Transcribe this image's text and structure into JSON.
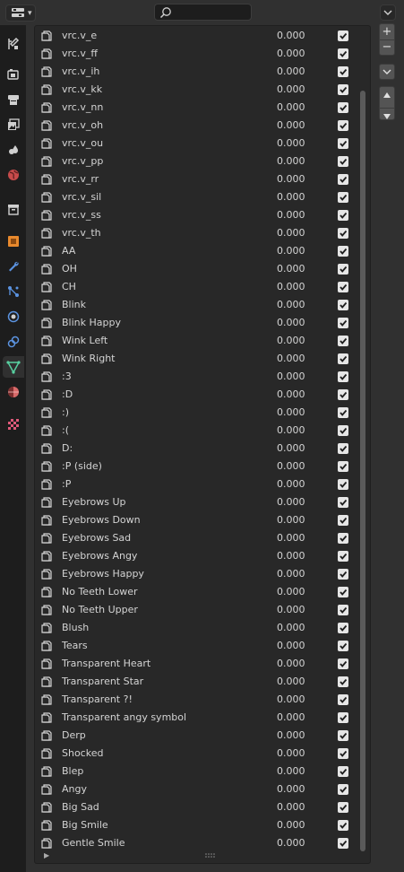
{
  "header": {
    "editor_type_icon": "properties-editor-icon",
    "search": {
      "value": "",
      "placeholder": ""
    }
  },
  "sidebar": {
    "tabs": [
      {
        "name": "tool",
        "icon": "tool-settings-icon"
      },
      {
        "name": "render",
        "icon": "render-icon"
      },
      {
        "name": "output",
        "icon": "output-icon"
      },
      {
        "name": "view-layer",
        "icon": "view-layer-icon"
      },
      {
        "name": "scene",
        "icon": "scene-icon"
      },
      {
        "name": "world",
        "icon": "world-icon"
      },
      {
        "name": "collection",
        "icon": "collection-icon"
      },
      {
        "name": "object",
        "icon": "object-icon"
      },
      {
        "name": "modifiers",
        "icon": "wrench-icon"
      },
      {
        "name": "particles",
        "icon": "particles-icon"
      },
      {
        "name": "physics",
        "icon": "physics-icon"
      },
      {
        "name": "constraints",
        "icon": "constraints-icon"
      },
      {
        "name": "data",
        "icon": "mesh-data-icon",
        "active": true
      },
      {
        "name": "material",
        "icon": "material-icon"
      },
      {
        "name": "texture",
        "icon": "texture-icon"
      }
    ]
  },
  "shape_keys": {
    "items": [
      {
        "name": "vrc.v_e",
        "value": "0.000",
        "enabled": true
      },
      {
        "name": "vrc.v_ff",
        "value": "0.000",
        "enabled": true
      },
      {
        "name": "vrc.v_ih",
        "value": "0.000",
        "enabled": true
      },
      {
        "name": "vrc.v_kk",
        "value": "0.000",
        "enabled": true
      },
      {
        "name": "vrc.v_nn",
        "value": "0.000",
        "enabled": true
      },
      {
        "name": "vrc.v_oh",
        "value": "0.000",
        "enabled": true
      },
      {
        "name": "vrc.v_ou",
        "value": "0.000",
        "enabled": true
      },
      {
        "name": "vrc.v_pp",
        "value": "0.000",
        "enabled": true
      },
      {
        "name": "vrc.v_rr",
        "value": "0.000",
        "enabled": true
      },
      {
        "name": "vrc.v_sil",
        "value": "0.000",
        "enabled": true
      },
      {
        "name": "vrc.v_ss",
        "value": "0.000",
        "enabled": true
      },
      {
        "name": "vrc.v_th",
        "value": "0.000",
        "enabled": true
      },
      {
        "name": "AA",
        "value": "0.000",
        "enabled": true
      },
      {
        "name": "OH",
        "value": "0.000",
        "enabled": true
      },
      {
        "name": "CH",
        "value": "0.000",
        "enabled": true
      },
      {
        "name": "Blink",
        "value": "0.000",
        "enabled": true
      },
      {
        "name": "Blink Happy",
        "value": "0.000",
        "enabled": true
      },
      {
        "name": "Wink Left",
        "value": "0.000",
        "enabled": true
      },
      {
        "name": "Wink Right",
        "value": "0.000",
        "enabled": true
      },
      {
        "name": ":3",
        "value": "0.000",
        "enabled": true
      },
      {
        "name": ":D",
        "value": "0.000",
        "enabled": true
      },
      {
        "name": ":)",
        "value": "0.000",
        "enabled": true
      },
      {
        "name": ":(",
        "value": "0.000",
        "enabled": true
      },
      {
        "name": "D:",
        "value": "0.000",
        "enabled": true
      },
      {
        "name": ":P (side)",
        "value": "0.000",
        "enabled": true
      },
      {
        "name": ":P",
        "value": "0.000",
        "enabled": true
      },
      {
        "name": "Eyebrows Up",
        "value": "0.000",
        "enabled": true
      },
      {
        "name": "Eyebrows Down",
        "value": "0.000",
        "enabled": true
      },
      {
        "name": "Eyebrows Sad",
        "value": "0.000",
        "enabled": true
      },
      {
        "name": "Eyebrows Angy",
        "value": "0.000",
        "enabled": true
      },
      {
        "name": "Eyebrows Happy",
        "value": "0.000",
        "enabled": true
      },
      {
        "name": "No Teeth Lower",
        "value": "0.000",
        "enabled": true
      },
      {
        "name": "No Teeth Upper",
        "value": "0.000",
        "enabled": true
      },
      {
        "name": "Blush",
        "value": "0.000",
        "enabled": true
      },
      {
        "name": "Tears",
        "value": "0.000",
        "enabled": true
      },
      {
        "name": "Transparent Heart",
        "value": "0.000",
        "enabled": true
      },
      {
        "name": "Transparent Star",
        "value": "0.000",
        "enabled": true
      },
      {
        "name": "Transparent ?!",
        "value": "0.000",
        "enabled": true
      },
      {
        "name": "Transparent angy symbol",
        "value": "0.000",
        "enabled": true
      },
      {
        "name": "Derp",
        "value": "0.000",
        "enabled": true
      },
      {
        "name": "Shocked",
        "value": "0.000",
        "enabled": true
      },
      {
        "name": "Blep",
        "value": "0.000",
        "enabled": true
      },
      {
        "name": "Angy",
        "value": "0.000",
        "enabled": true
      },
      {
        "name": "Big Sad",
        "value": "0.000",
        "enabled": true
      },
      {
        "name": "Big Smile",
        "value": "0.000",
        "enabled": true
      },
      {
        "name": "Gentle Smile",
        "value": "0.000",
        "enabled": true
      }
    ],
    "side_buttons": {
      "add_label": "+",
      "remove_label": "−"
    }
  },
  "colors": {
    "background": "#303030",
    "list_background": "#282828",
    "tab_strip": "#1d1d1d",
    "checkbox": "#e6e6e6"
  }
}
